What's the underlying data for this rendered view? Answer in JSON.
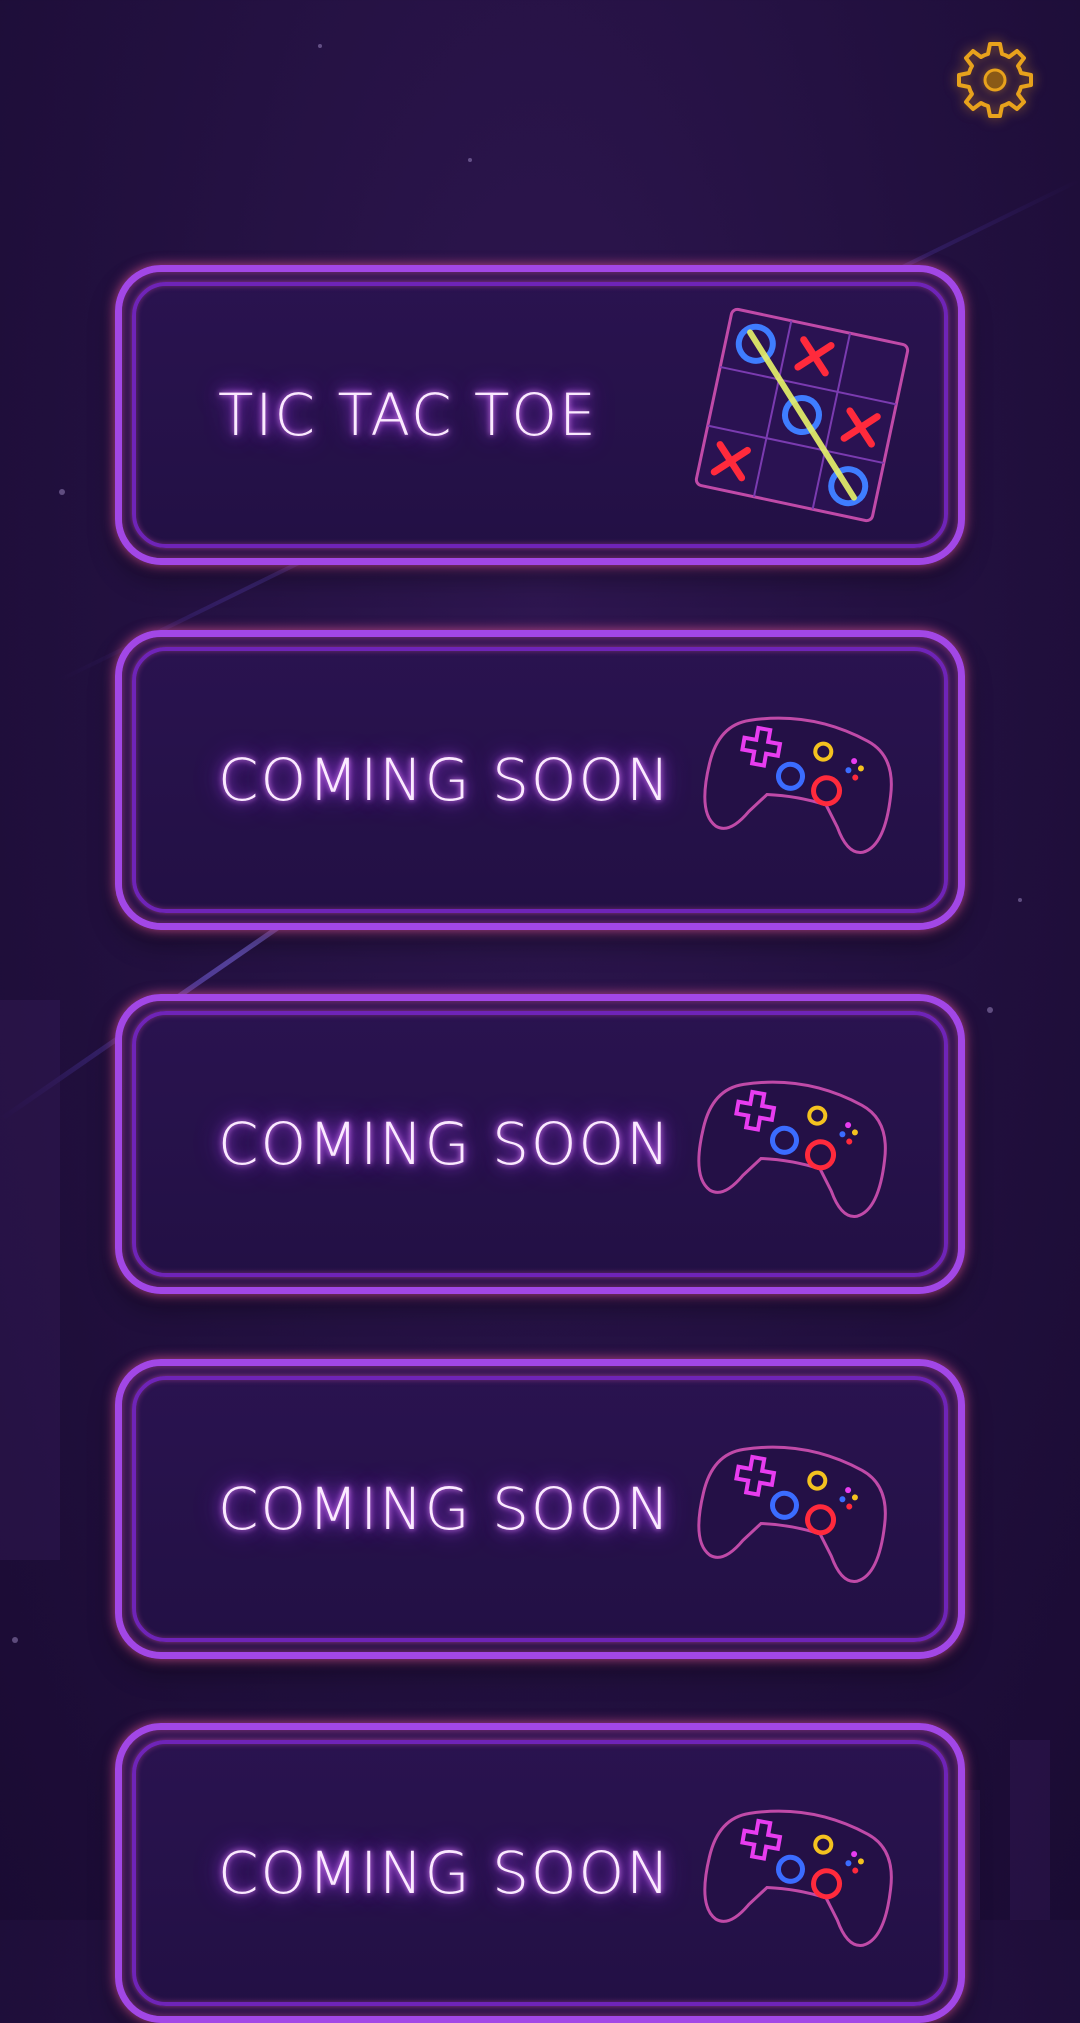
{
  "header": {
    "settings_icon": "gear-icon",
    "settings_color": "#e8a21c"
  },
  "theme": {
    "card_border": "#a247e6",
    "card_glow": "#f05aa0",
    "text_glow": "#b248ff"
  },
  "cards": [
    {
      "title": "TIC TAC TOE",
      "icon": "tic-tac-toe-icon"
    },
    {
      "title": "COMING SOON",
      "icon": "gamepad-icon"
    },
    {
      "title": "COMING SOON",
      "icon": "gamepad-icon"
    },
    {
      "title": "COMING SOON",
      "icon": "gamepad-icon"
    },
    {
      "title": "COMING SOON",
      "icon": "gamepad-icon"
    }
  ]
}
